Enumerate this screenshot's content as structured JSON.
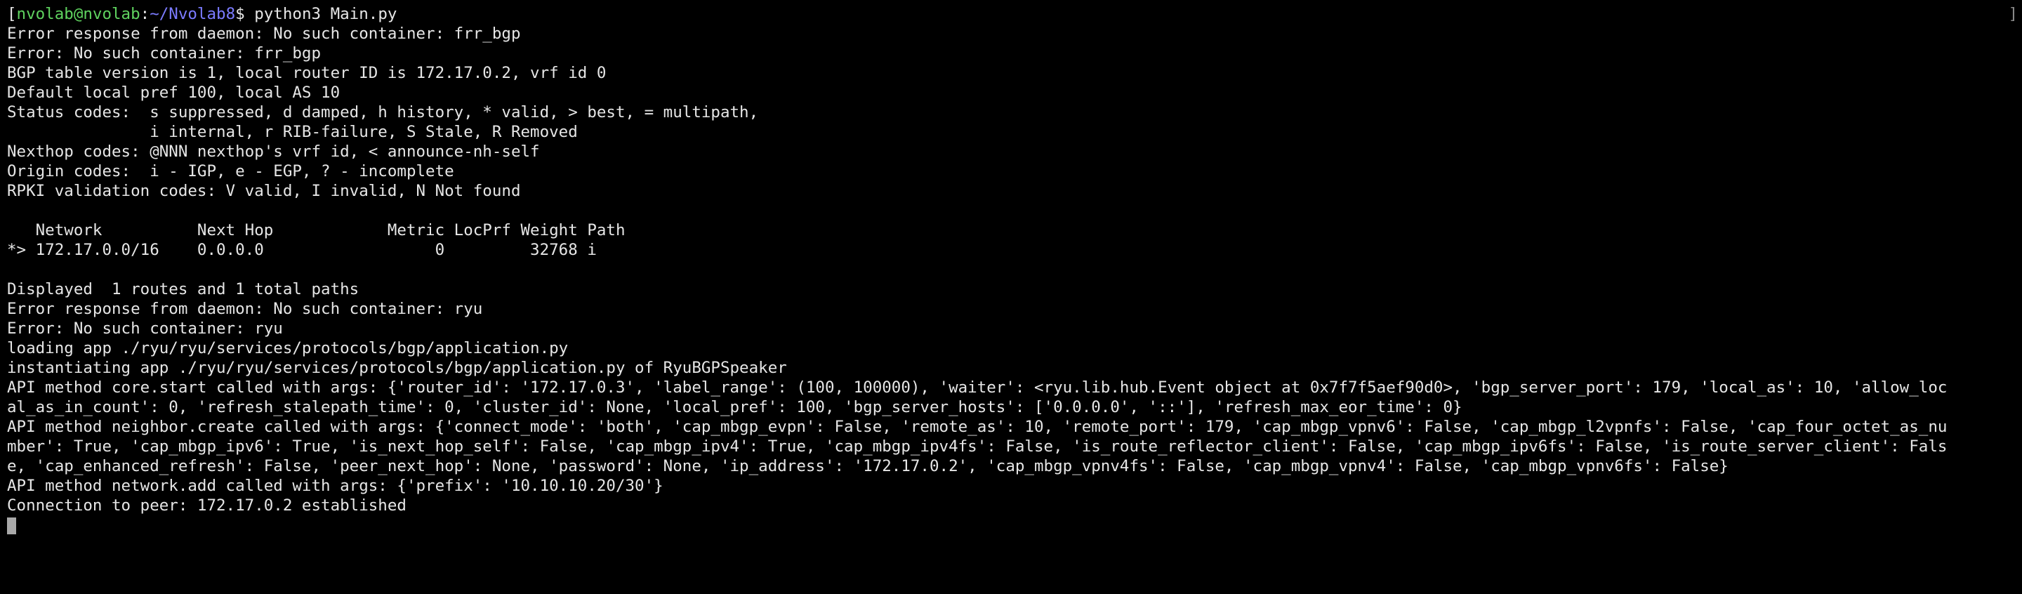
{
  "terminal": {
    "top_sliver": "                ",
    "prompt": {
      "user_host": "nvolab@nvolab",
      "separator": ":",
      "path": "~/Nvolab8",
      "dollar": "$ ",
      "command": "python3 Main.py"
    },
    "right_bracket": "]",
    "output_lines": [
      "Error response from daemon: No such container: frr_bgp",
      "Error: No such container: frr_bgp",
      "BGP table version is 1, local router ID is 172.17.0.2, vrf id 0",
      "Default local pref 100, local AS 10",
      "Status codes:  s suppressed, d damped, h history, * valid, > best, = multipath,",
      "               i internal, r RIB-failure, S Stale, R Removed",
      "Nexthop codes: @NNN nexthop's vrf id, < announce-nh-self",
      "Origin codes:  i - IGP, e - EGP, ? - incomplete",
      "RPKI validation codes: V valid, I invalid, N Not found",
      "",
      "   Network          Next Hop            Metric LocPrf Weight Path",
      "*> 172.17.0.0/16    0.0.0.0                  0         32768 i",
      "",
      "Displayed  1 routes and 1 total paths",
      "Error response from daemon: No such container: ryu",
      "Error: No such container: ryu",
      "loading app ./ryu/ryu/services/protocols/bgp/application.py",
      "instantiating app ./ryu/ryu/services/protocols/bgp/application.py of RyuBGPSpeaker",
      "API method core.start called with args: {'router_id': '172.17.0.3', 'label_range': (100, 100000), 'waiter': <ryu.lib.hub.Event object at 0x7f7f5aef90d0>, 'bgp_server_port': 179, 'local_as': 10, 'allow_loc",
      "al_as_in_count': 0, 'refresh_stalepath_time': 0, 'cluster_id': None, 'local_pref': 100, 'bgp_server_hosts': ['0.0.0.0', '::'], 'refresh_max_eor_time': 0}",
      "API method neighbor.create called with args: {'connect_mode': 'both', 'cap_mbgp_evpn': False, 'remote_as': 10, 'remote_port': 179, 'cap_mbgp_vpnv6': False, 'cap_mbgp_l2vpnfs': False, 'cap_four_octet_as_nu",
      "mber': True, 'cap_mbgp_ipv6': True, 'is_next_hop_self': False, 'cap_mbgp_ipv4': True, 'cap_mbgp_ipv4fs': False, 'is_route_reflector_client': False, 'cap_mbgp_ipv6fs': False, 'is_route_server_client': Fals",
      "e, 'cap_enhanced_refresh': False, 'peer_next_hop': None, 'password': None, 'ip_address': '172.17.0.2', 'cap_mbgp_vpnv4fs': False, 'cap_mbgp_vpnv4': False, 'cap_mbgp_vpnv6fs': False}",
      "API method network.add called with args: {'prefix': '10.10.10.20/30'}",
      "Connection to peer: 172.17.0.2 established"
    ]
  }
}
